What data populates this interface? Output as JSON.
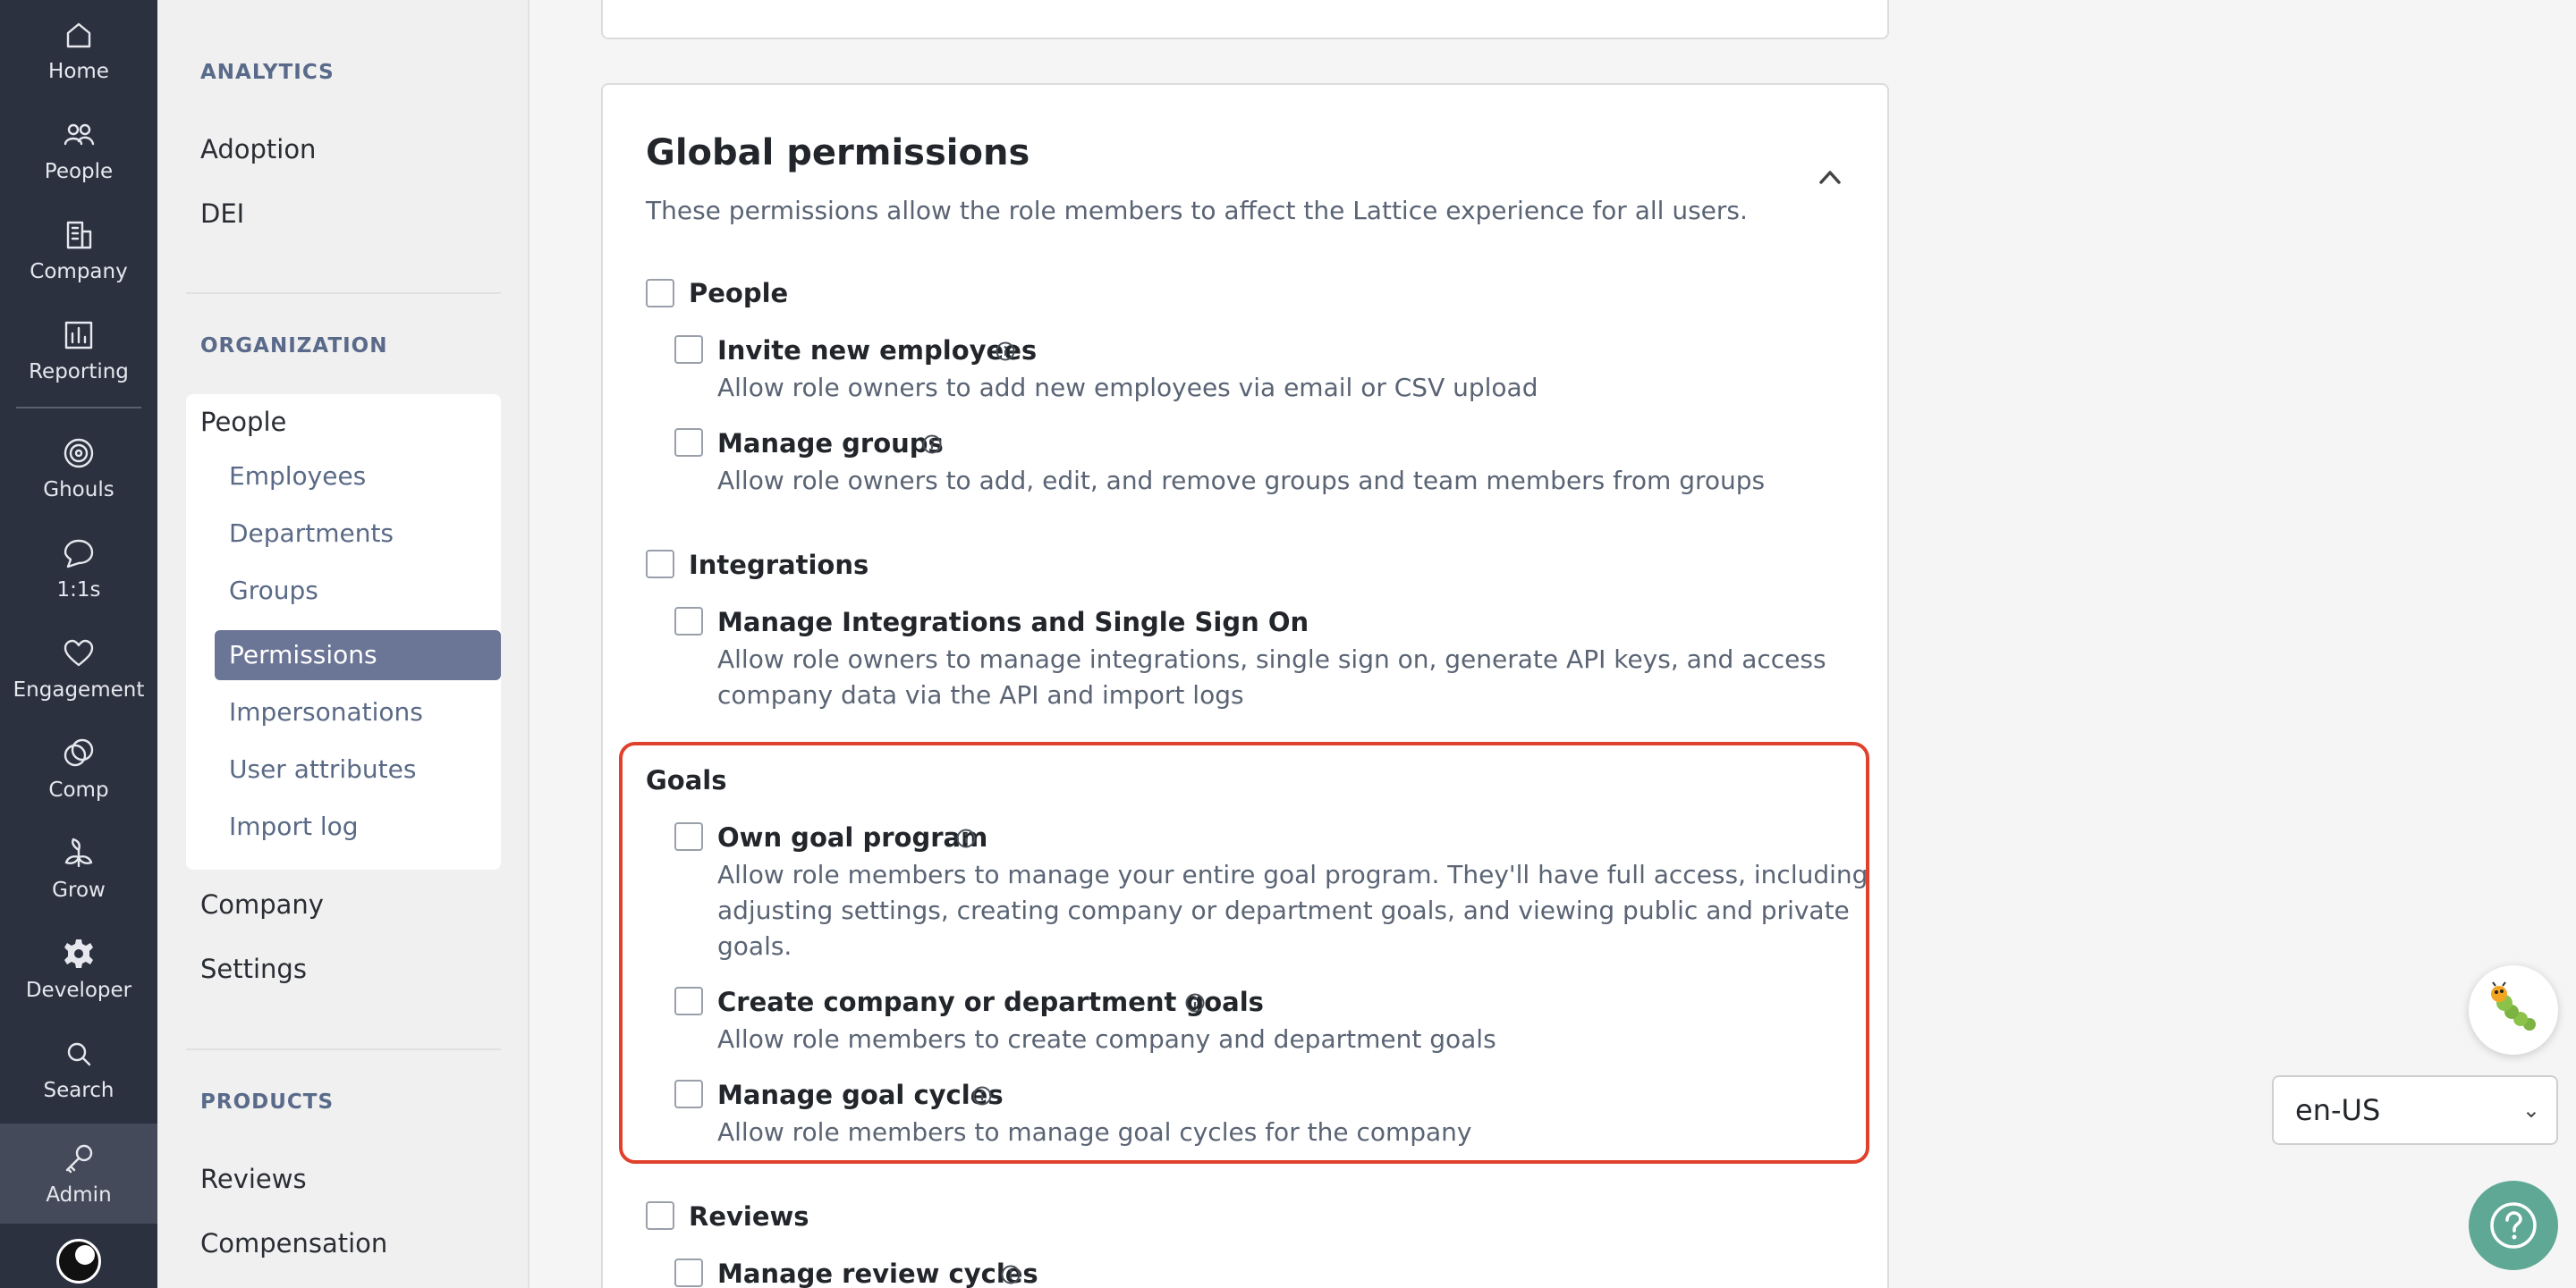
{
  "rail": {
    "items": [
      {
        "label": "Home",
        "icon": "home-icon"
      },
      {
        "label": "People",
        "icon": "people-icon"
      },
      {
        "label": "Company",
        "icon": "building-icon"
      },
      {
        "label": "Reporting",
        "icon": "bar-chart-icon"
      },
      {
        "label": "Ghouls",
        "icon": "target-icon"
      },
      {
        "label": "1:1s",
        "icon": "chat-bubble-icon"
      },
      {
        "label": "Engagement",
        "icon": "heart-icon"
      },
      {
        "label": "Comp",
        "icon": "coins-icon"
      },
      {
        "label": "Grow",
        "icon": "plant-icon"
      },
      {
        "label": "Developer",
        "icon": "gear-icon"
      },
      {
        "label": "Search",
        "icon": "search-icon"
      },
      {
        "label": "Admin",
        "icon": "key-icon"
      }
    ],
    "active": "Admin"
  },
  "subnav": {
    "analytics_header": "ANALYTICS",
    "analytics_links": [
      "Adoption",
      "DEI"
    ],
    "organization_header": "ORGANIZATION",
    "people_label": "People",
    "people_sub": [
      "Employees",
      "Departments",
      "Groups",
      "Permissions",
      "Impersonations",
      "User attributes",
      "Import log"
    ],
    "active_sub": "Permissions",
    "org_links": [
      "Company",
      "Settings"
    ],
    "products_header": "PRODUCTS",
    "products_links": [
      "Reviews",
      "Compensation"
    ]
  },
  "card": {
    "title": "Global permissions",
    "subtitle": "These permissions allow the role members to affect the Lattice experience for all users."
  },
  "permissions": {
    "people": {
      "label": "People",
      "invite_title": "Invite new employees",
      "invite_desc": "Allow role owners to add new employees via email or CSV upload",
      "groups_title": "Manage groups",
      "groups_desc": "Allow role owners to add, edit, and remove groups and team members from groups"
    },
    "integrations": {
      "label": "Integrations",
      "sso_title": "Manage Integrations and Single Sign On",
      "sso_desc_1": "Allow role owners to manage integrations, single sign on, generate API keys, and access",
      "sso_desc_2": "company data via the API and import logs"
    },
    "goals": {
      "label": "Goals",
      "own_title": "Own goal program",
      "own_desc_1": "Allow role members to manage your entire goal program. They'll have full access, including",
      "own_desc_2": "adjusting settings, creating company or department goals, and viewing public and private",
      "own_desc_3": "goals.",
      "create_title": "Create company or department goals",
      "create_desc": "Allow role members to create company and department goals",
      "cycles_title": "Manage goal cycles",
      "cycles_desc": "Allow role members to manage goal cycles for the company"
    },
    "reviews": {
      "label": "Reviews",
      "review_cycles_title": "Manage review cycles"
    }
  },
  "widgets": {
    "language": "en-US",
    "help_icon": "question-mark-icon",
    "bug_icon": "caterpillar-icon"
  },
  "colors": {
    "rail_bg": "#2c3140",
    "active_sub_bg": "#6b7596",
    "highlight_border": "#e0412c",
    "help_bg": "#5fa895"
  }
}
